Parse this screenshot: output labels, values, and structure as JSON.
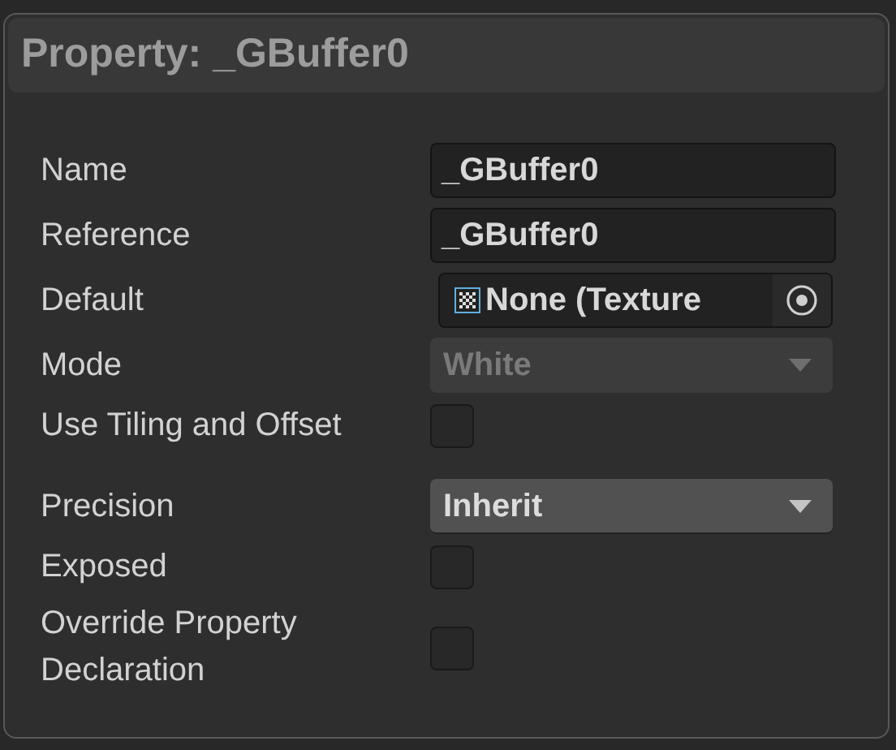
{
  "title": "Property: _GBuffer0",
  "rows": [
    {
      "label": "Name",
      "kind": "text",
      "value": "_GBuffer0"
    },
    {
      "label": "Reference",
      "kind": "text",
      "value": "_GBuffer0"
    },
    {
      "label": "Default",
      "kind": "object",
      "value": "None (Texture"
    },
    {
      "label": "Mode",
      "kind": "dropdown",
      "value": "White",
      "disabled": true
    },
    {
      "label": "Use Tiling and Offset",
      "kind": "checkbox",
      "checked": false
    },
    {
      "label": "Precision",
      "kind": "dropdown",
      "value": "Inherit",
      "disabled": false
    },
    {
      "label": "Exposed",
      "kind": "checkbox",
      "checked": false
    },
    {
      "label": "Override Property Declaration",
      "kind": "checkbox",
      "checked": false
    }
  ]
}
